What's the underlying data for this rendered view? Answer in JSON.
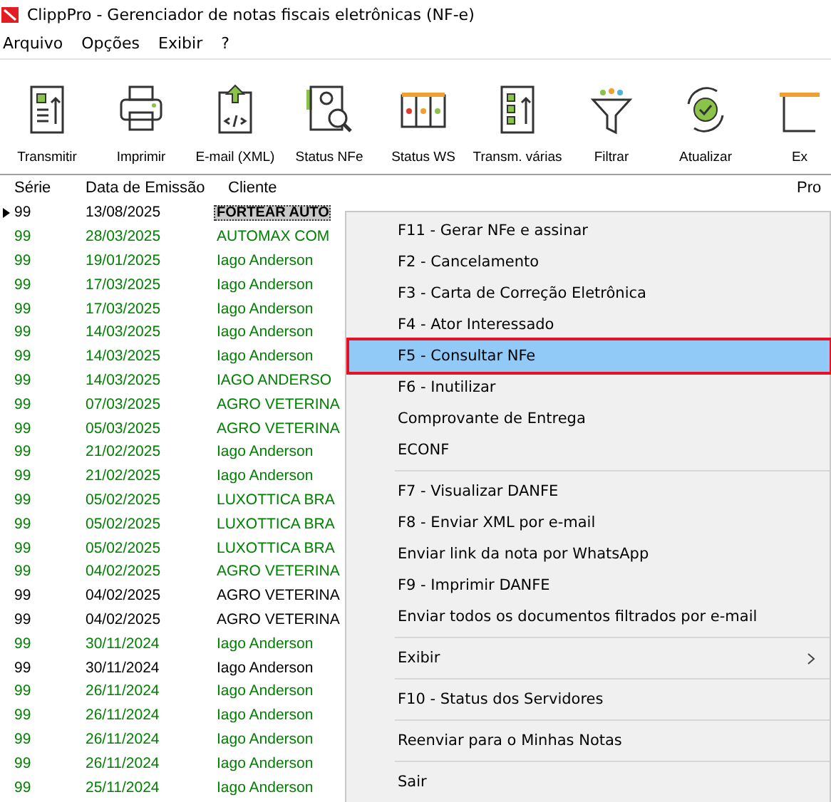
{
  "window": {
    "title": "ClippPro - Gerenciador de notas fiscais eletrônicas (NF-e)"
  },
  "menu_bar": [
    "Arquivo",
    "Opções",
    "Exibir",
    "?"
  ],
  "toolbar": [
    {
      "label": "Transmitir",
      "kind": "transmit"
    },
    {
      "label": "Imprimir",
      "kind": "print"
    },
    {
      "label": "E-mail (XML)",
      "kind": "xml"
    },
    {
      "label": "Status NFe",
      "kind": "status"
    },
    {
      "label": "Status WS",
      "kind": "ws"
    },
    {
      "label": "Transm. várias",
      "kind": "multi"
    },
    {
      "label": "Filtrar",
      "kind": "filter"
    },
    {
      "label": "Atualizar",
      "kind": "refresh"
    },
    {
      "label": "Ex",
      "kind": "trash"
    }
  ],
  "table": {
    "columns": [
      "Série",
      "Data de Emissão",
      "Cliente",
      "Pro"
    ],
    "rows": [
      {
        "serie": "99",
        "date": "13/08/2025",
        "client": "FORTEAR AUTO",
        "color": "#000000",
        "selected": true
      },
      {
        "serie": "99",
        "date": "28/03/2025",
        "client": "AUTOMAX COM",
        "color": "#008000",
        "selected": false
      },
      {
        "serie": "99",
        "date": "19/01/2025",
        "client": "Iago Anderson",
        "color": "#008000",
        "selected": false
      },
      {
        "serie": "99",
        "date": "17/03/2025",
        "client": "Iago Anderson",
        "color": "#008000",
        "selected": false
      },
      {
        "serie": "99",
        "date": "17/03/2025",
        "client": "Iago Anderson",
        "color": "#008000",
        "selected": false
      },
      {
        "serie": "99",
        "date": "14/03/2025",
        "client": "Iago Anderson",
        "color": "#008000",
        "selected": false
      },
      {
        "serie": "99",
        "date": "14/03/2025",
        "client": "Iago Anderson",
        "color": "#008000",
        "selected": false
      },
      {
        "serie": "99",
        "date": "14/03/2025",
        "client": "IAGO ANDERSO",
        "color": "#008000",
        "selected": false
      },
      {
        "serie": "99",
        "date": "07/03/2025",
        "client": "AGRO VETERINA",
        "color": "#008000",
        "selected": false
      },
      {
        "serie": "99",
        "date": "05/03/2025",
        "client": "AGRO VETERINA",
        "color": "#008000",
        "selected": false
      },
      {
        "serie": "99",
        "date": "21/02/2025",
        "client": "Iago Anderson",
        "color": "#008000",
        "selected": false
      },
      {
        "serie": "99",
        "date": "21/02/2025",
        "client": "Iago Anderson",
        "color": "#008000",
        "selected": false
      },
      {
        "serie": "99",
        "date": "05/02/2025",
        "client": "LUXOTTICA BRA",
        "color": "#008000",
        "selected": false
      },
      {
        "serie": "99",
        "date": "05/02/2025",
        "client": "LUXOTTICA BRA",
        "color": "#008000",
        "selected": false
      },
      {
        "serie": "99",
        "date": "05/02/2025",
        "client": "LUXOTTICA BRA",
        "color": "#008000",
        "selected": false
      },
      {
        "serie": "99",
        "date": "04/02/2025",
        "client": "AGRO VETERINA",
        "color": "#008000",
        "selected": false
      },
      {
        "serie": "99",
        "date": "04/02/2025",
        "client": "AGRO VETERINA",
        "color": "#000000",
        "selected": false
      },
      {
        "serie": "99",
        "date": "04/02/2025",
        "client": "AGRO VETERINA",
        "color": "#000000",
        "selected": false
      },
      {
        "serie": "99",
        "date": "30/11/2024",
        "client": "Iago Anderson",
        "color": "#008000",
        "selected": false
      },
      {
        "serie": "99",
        "date": "30/11/2024",
        "client": "Iago Anderson",
        "color": "#000000",
        "selected": false
      },
      {
        "serie": "99",
        "date": "26/11/2024",
        "client": "Iago Anderson",
        "color": "#008000",
        "selected": false
      },
      {
        "serie": "99",
        "date": "26/11/2024",
        "client": "Iago Anderson",
        "color": "#008000",
        "selected": false
      },
      {
        "serie": "99",
        "date": "26/11/2024",
        "client": "Iago Anderson",
        "color": "#008000",
        "selected": false
      },
      {
        "serie": "99",
        "date": "26/11/2024",
        "client": "Iago Anderson",
        "color": "#008000",
        "selected": false
      },
      {
        "serie": "99",
        "date": "25/11/2024",
        "client": "Iago Anderson",
        "color": "#008000",
        "selected": false
      }
    ]
  },
  "context_menu": [
    {
      "kind": "item",
      "label": "F11 - Gerar NFe e assinar",
      "selected": false
    },
    {
      "kind": "item",
      "label": "F2 - Cancelamento",
      "selected": false
    },
    {
      "kind": "item",
      "label": "F3 - Carta de Correção Eletrônica",
      "selected": false
    },
    {
      "kind": "item",
      "label": "F4 - Ator Interessado",
      "selected": false
    },
    {
      "kind": "item",
      "label": "F5 - Consultar NFe",
      "selected": true
    },
    {
      "kind": "item",
      "label": "F6 - Inutilizar",
      "selected": false
    },
    {
      "kind": "item",
      "label": "Comprovante de Entrega",
      "selected": false
    },
    {
      "kind": "item",
      "label": "ECONF",
      "selected": false
    },
    {
      "kind": "separator"
    },
    {
      "kind": "item",
      "label": "F7 - Visualizar DANFE",
      "selected": false
    },
    {
      "kind": "item",
      "label": "F8 - Enviar XML por e-mail",
      "selected": false
    },
    {
      "kind": "item",
      "label": "Enviar link da nota por WhatsApp",
      "selected": false
    },
    {
      "kind": "item",
      "label": "F9 - Imprimir DANFE",
      "selected": false
    },
    {
      "kind": "item",
      "label": "Enviar todos os documentos filtrados por e-mail",
      "selected": false
    },
    {
      "kind": "separator"
    },
    {
      "kind": "submenu",
      "label": "Exibir",
      "selected": false
    },
    {
      "kind": "separator"
    },
    {
      "kind": "item",
      "label": "F10 - Status dos Servidores",
      "selected": false
    },
    {
      "kind": "separator"
    },
    {
      "kind": "item",
      "label": "Reenviar para o Minhas Notas",
      "selected": false
    },
    {
      "kind": "separator"
    },
    {
      "kind": "item",
      "label": "Sair",
      "selected": false
    }
  ]
}
